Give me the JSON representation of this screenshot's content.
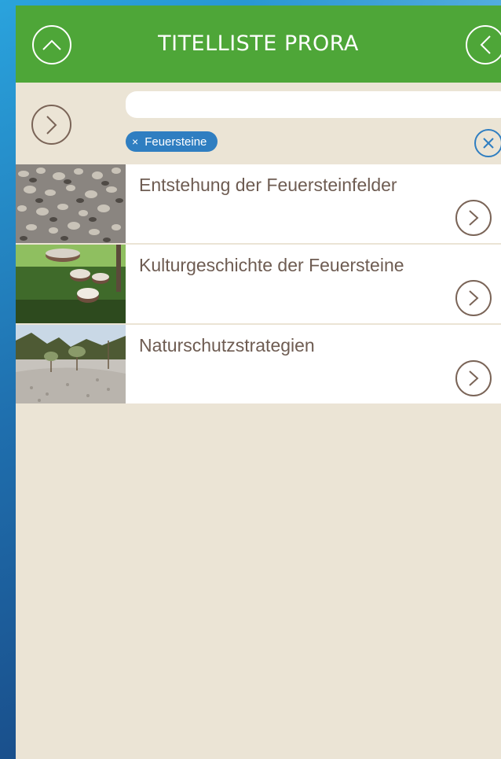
{
  "header": {
    "title": "TITELLISTE PRORA",
    "up_icon": "chevron-up-icon",
    "back_icon": "chevron-left-icon"
  },
  "filter": {
    "search_value": "",
    "search_placeholder": "",
    "active_tag": "Feuersteine",
    "tag_remove_glyph": "×",
    "next_icon": "chevron-right-icon",
    "clear_icon": "close-icon"
  },
  "list": {
    "items": [
      {
        "title": "Entstehung der Feuersteinfelder",
        "thumb": "pebbles-image",
        "arrow_icon": "chevron-right-icon"
      },
      {
        "title": "Kulturgeschichte der Feuersteine",
        "thumb": "mushrooms-image",
        "arrow_icon": "chevron-right-icon"
      },
      {
        "title": "Naturschutzstrategien",
        "thumb": "landscape-image",
        "arrow_icon": "chevron-right-icon"
      }
    ]
  },
  "colors": {
    "header_green": "#4ea638",
    "content_bg": "#ebe4d5",
    "tag_blue": "#2f7ec1",
    "title_brown": "#6e5c52"
  }
}
